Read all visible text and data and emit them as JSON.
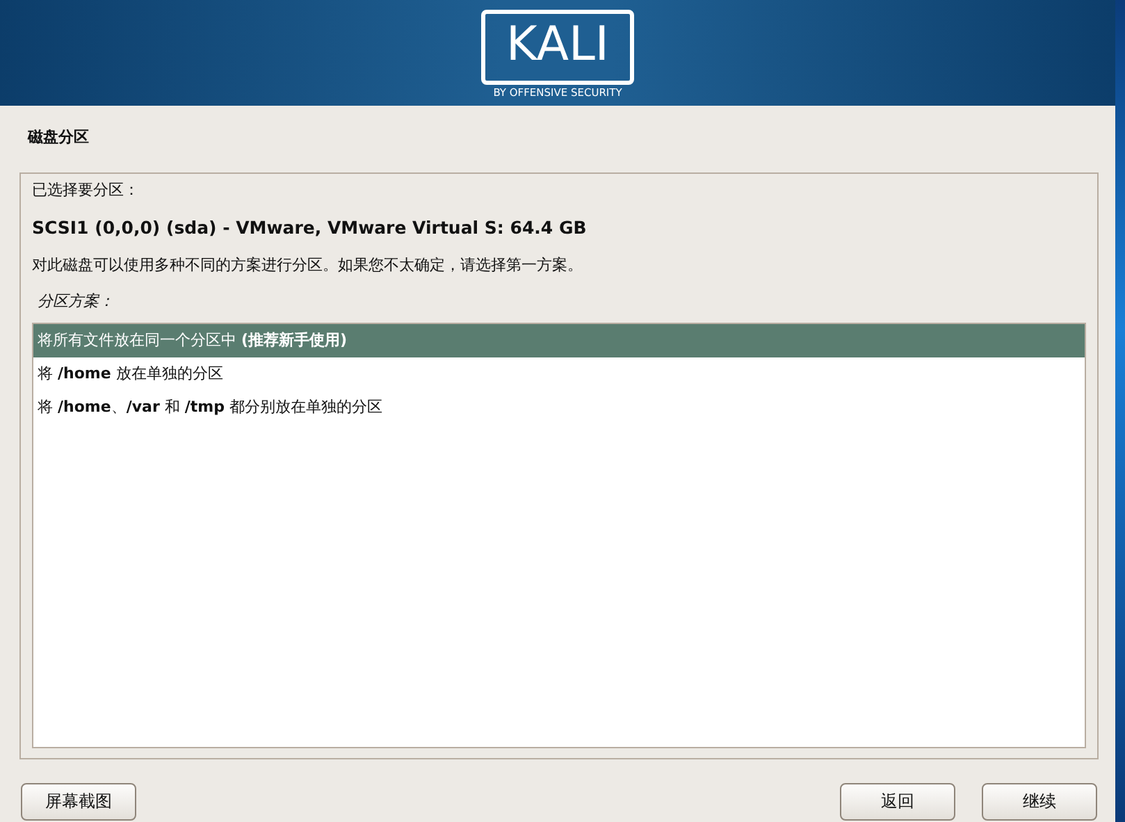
{
  "banner": {
    "logo": "KALI",
    "tagline": "BY OFFENSIVE SECURITY"
  },
  "page_title": "磁盘分区",
  "selected_label": "已选择要分区：",
  "disk": "SCSI1 (0,0,0) (sda) - VMware, VMware Virtual S: 64.4 GB",
  "description": "对此磁盘可以使用多种不同的方案进行分区。如果您不太确定，请选择第一方案。",
  "scheme_label": "分区方案：",
  "options": [
    {
      "label": "将所有文件放在同一个分区中 **(推荐新手使用)**",
      "selected": true
    },
    {
      "label": "将 **/home** 放在单独的分区",
      "selected": false
    },
    {
      "label": "将 **/home**、**/var** 和 **/tmp** 都分别放在单独的分区",
      "selected": false
    }
  ],
  "buttons": {
    "screenshot": "屏幕截图",
    "back": "返回",
    "continue": "继续"
  }
}
